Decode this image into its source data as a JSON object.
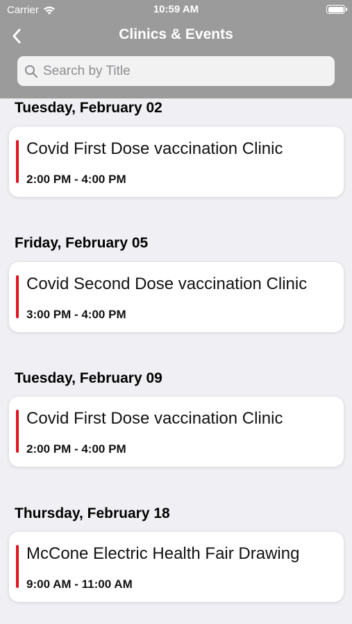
{
  "status_bar": {
    "carrier": "Carrier",
    "time": "10:59 AM"
  },
  "nav": {
    "title": "Clinics & Events"
  },
  "search": {
    "placeholder": "Search by Title",
    "value": ""
  },
  "colors": {
    "header_bg": "#9b9b9b",
    "accent": "#e0141e",
    "background": "#f0f0f4"
  },
  "sections": [
    {
      "date": "Tuesday, February 02",
      "events": [
        {
          "title": "Covid First Dose vaccination Clinic",
          "time": "2:00 PM - 4:00 PM"
        }
      ]
    },
    {
      "date": "Friday, February 05",
      "events": [
        {
          "title": "Covid Second Dose vaccination Clinic",
          "time": "3:00 PM - 4:00 PM"
        }
      ]
    },
    {
      "date": "Tuesday, February 09",
      "events": [
        {
          "title": "Covid First Dose vaccination Clinic",
          "time": "2:00 PM - 4:00 PM"
        }
      ]
    },
    {
      "date": "Thursday, February 18",
      "events": [
        {
          "title": "McCone Electric Health Fair Drawing",
          "time": "9:00 AM - 11:00 AM"
        }
      ]
    }
  ]
}
